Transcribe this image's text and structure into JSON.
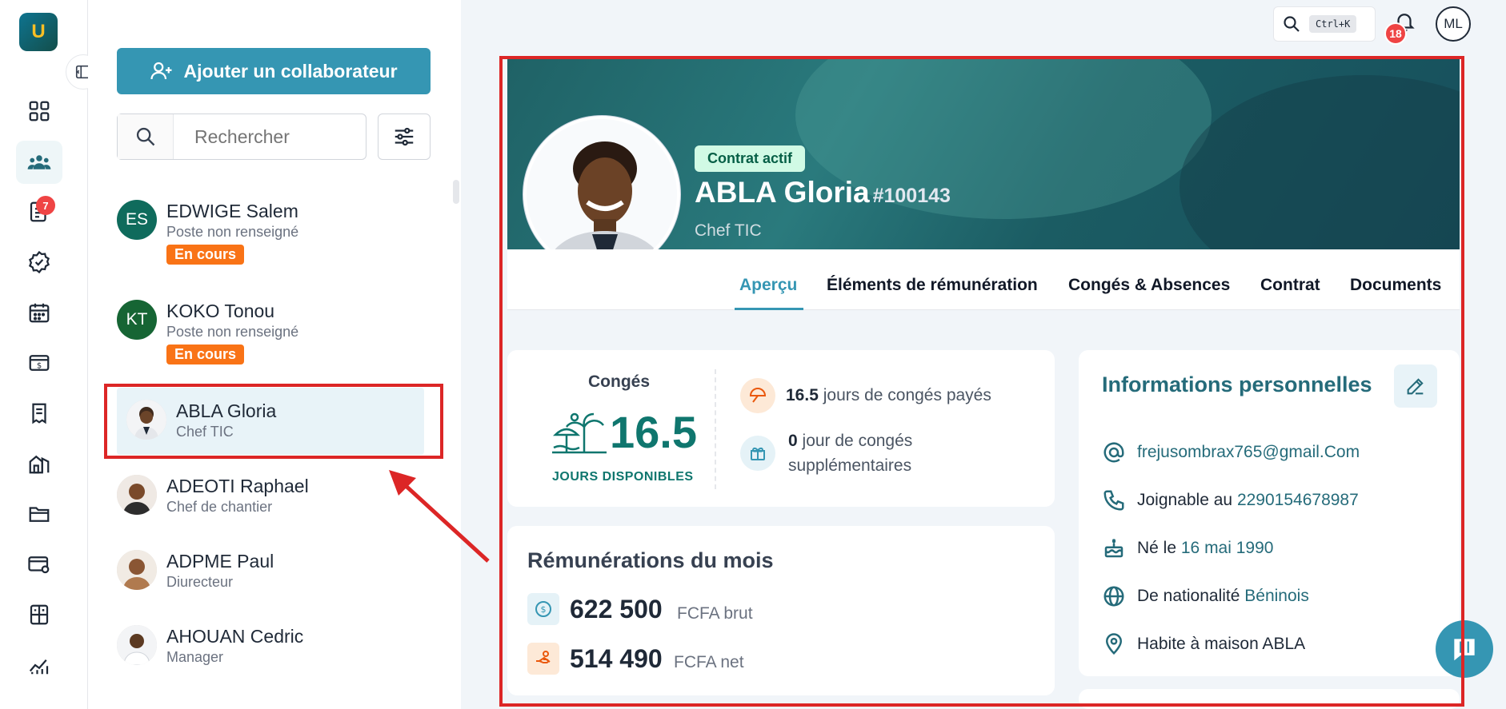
{
  "app": {
    "logo_letter": "U"
  },
  "rail": {
    "messages_badge": "7",
    "items": [
      "dashboard-icon",
      "people-icon",
      "document-icon",
      "check-badge-icon",
      "calendar-icon",
      "payroll-icon",
      "report-icon",
      "building-icon",
      "folder-icon",
      "card-settings-icon",
      "calculator-icon",
      "chart-icon"
    ]
  },
  "list_panel": {
    "add_button_label": "Ajouter un collaborateur",
    "search_placeholder": "Rechercher",
    "people": [
      {
        "initials": "ES",
        "name": "EDWIGE Salem",
        "role": "Poste non renseigné",
        "badge": "En cours",
        "color": "#0f6b5c"
      },
      {
        "initials": "KT",
        "name": "KOKO Tonou",
        "role": "Poste non renseigné",
        "badge": "En cours",
        "color": "#166534"
      },
      {
        "initials": "",
        "name": "ABLA Gloria",
        "role": "Chef TIC",
        "badge": ""
      },
      {
        "initials": "",
        "name": "ADEOTI Raphael",
        "role": "Chef de chantier",
        "badge": ""
      },
      {
        "initials": "",
        "name": "ADPME Paul",
        "role": "Diurecteur",
        "badge": ""
      },
      {
        "initials": "",
        "name": "AHOUAN Cedric",
        "role": "Manager",
        "badge": ""
      }
    ]
  },
  "topbar": {
    "shortcut": "Ctrl+K",
    "notifications_count": "18",
    "user_initials": "ML"
  },
  "profile": {
    "contract_status": "Contrat actif",
    "name": "ABLA Gloria",
    "employee_id": "#100143",
    "role": "Chef TIC"
  },
  "tabs": [
    "Aperçu",
    "Éléments de rémunération",
    "Congés & Absences",
    "Contrat",
    "Documents"
  ],
  "leave": {
    "title": "Congés",
    "available": "16.5",
    "available_label": "JOURS DISPONIBLES",
    "paid_days": "16.5",
    "paid_label": "jours de congés payés",
    "extra_days": "0",
    "extra_label_1": "jour de congés",
    "extra_label_2": "supplémentaires"
  },
  "remuneration": {
    "title": "Rémunérations du mois",
    "gross_amount": "622 500",
    "gross_unit": "FCFA brut",
    "net_amount": "514 490",
    "net_unit": "FCFA net"
  },
  "personal_info": {
    "title": "Informations personnelles",
    "email": "frejusombrax765@gmail.Com",
    "phone_label": "Joignable au",
    "phone": "2290154678987",
    "birth_label": "Né le",
    "birth_date": "16 mai 1990",
    "nationality_label": "De nationalité",
    "nationality": "Béninois",
    "address_label": "Habite à",
    "address": "maison ABLA"
  },
  "colors": {
    "primary": "#3596b3",
    "teal": "#0f766e",
    "badge_orange": "#f97316",
    "highlight": "#dc2626"
  }
}
